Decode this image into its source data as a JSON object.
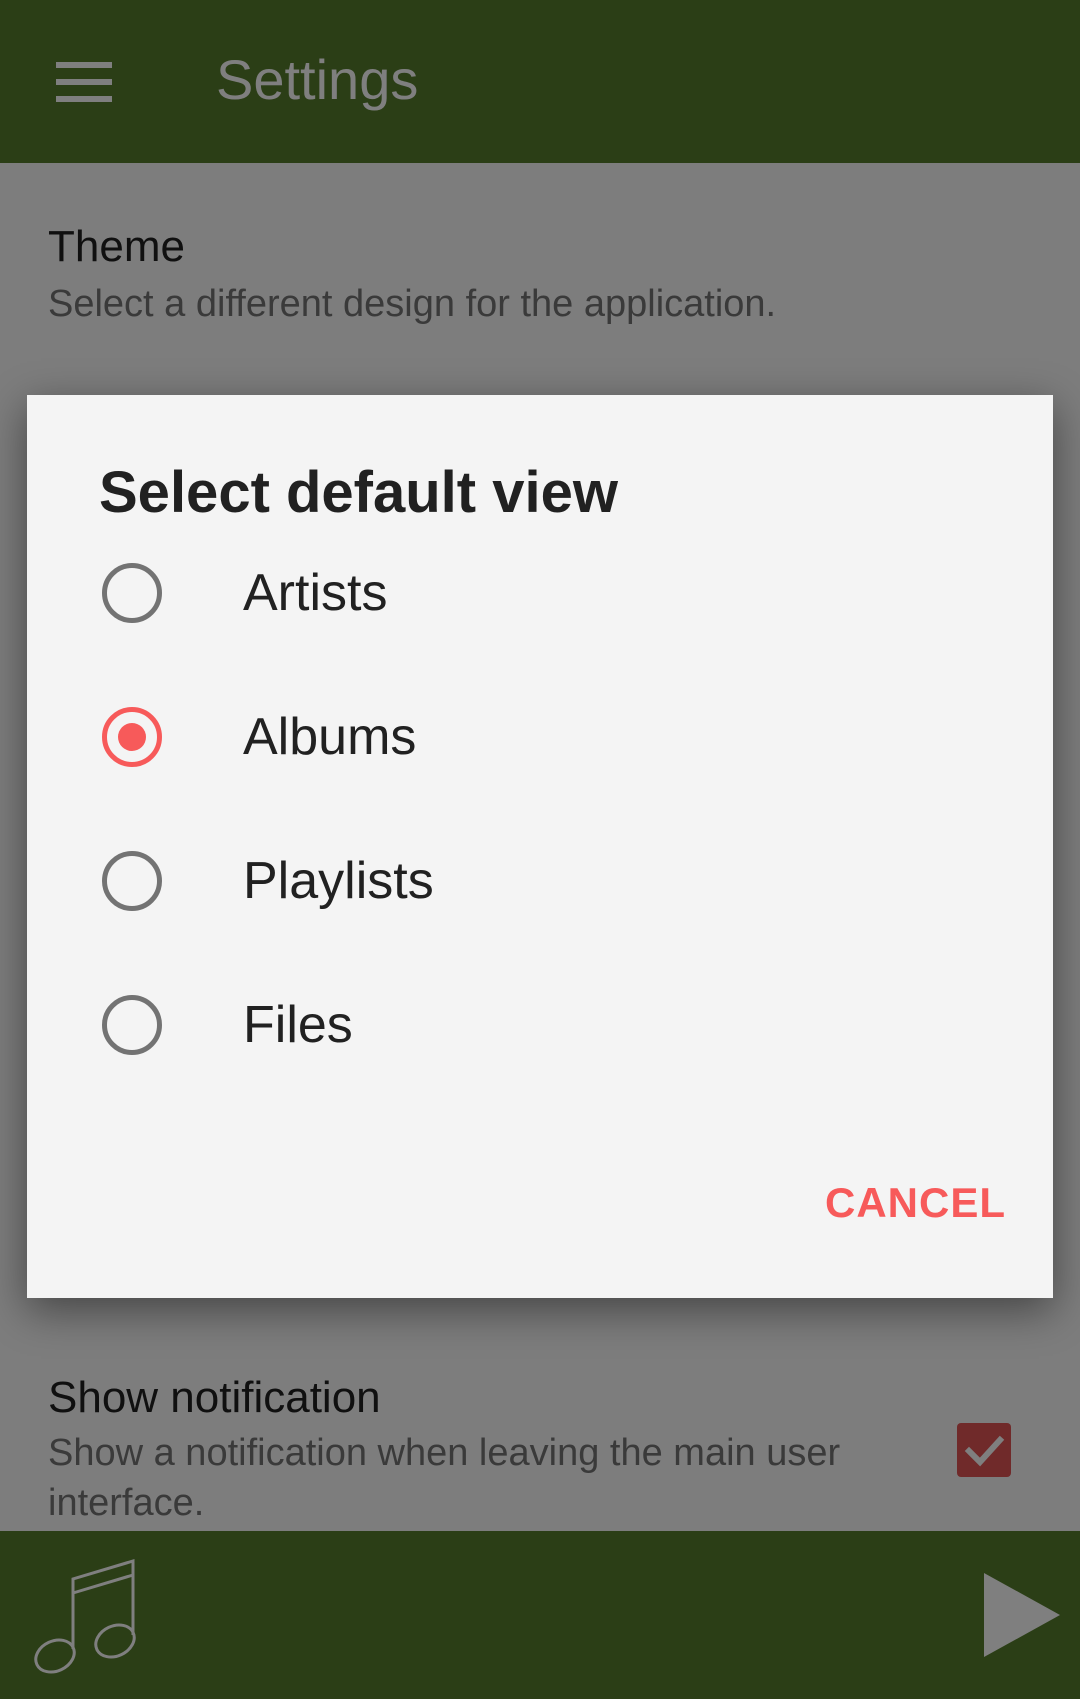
{
  "app_bar": {
    "title": "Settings",
    "menu_icon": "hamburger-menu-icon",
    "background": "#567d2d"
  },
  "settings": {
    "theme": {
      "title": "Theme",
      "summary": "Select a different design for the application."
    },
    "show_notification": {
      "title": "Show notification",
      "summary": "Show a notification when leaving the main user interface.",
      "checked": true
    }
  },
  "dialog": {
    "title": "Select default view",
    "options": [
      {
        "label": "Artists",
        "selected": false
      },
      {
        "label": "Albums",
        "selected": true
      },
      {
        "label": "Playlists",
        "selected": false
      },
      {
        "label": "Files",
        "selected": false
      }
    ],
    "cancel_label": "CANCEL",
    "accent": "#f75a5a"
  },
  "player_bar": {
    "album_icon": "music-note-icon",
    "play_icon": "play-icon"
  }
}
